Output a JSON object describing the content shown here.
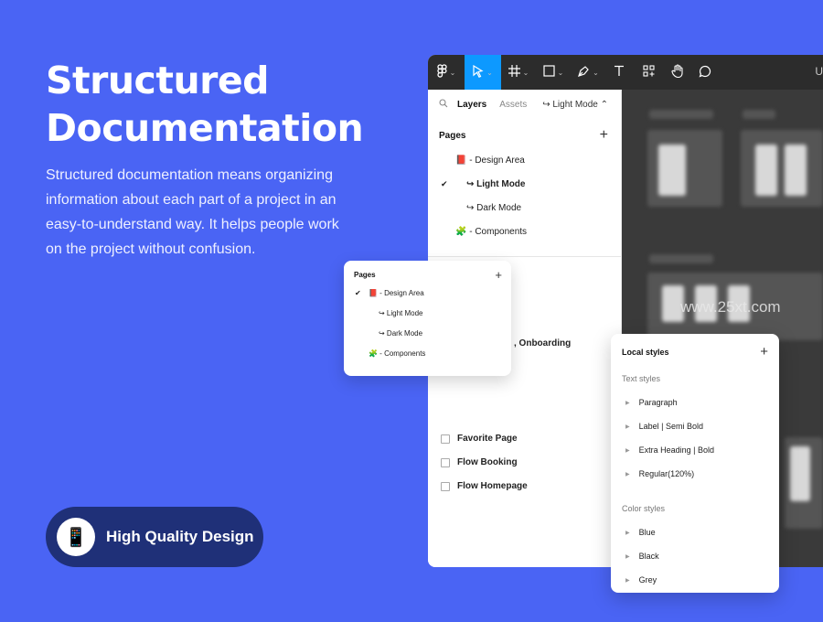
{
  "hero": {
    "title_line1": "Structured",
    "title_line2": "Documentation",
    "desc_lines": [
      "Structured documentation means organizing",
      "information about each part of a project in an",
      "easy-to-understand way. It helps people work",
      "on the project without confusion."
    ]
  },
  "badge": {
    "label": "High Quality Design",
    "icon": "📱"
  },
  "app": {
    "toolbar_user": "U",
    "tabs": {
      "layers": "Layers",
      "assets": "Assets",
      "mode": "↪ Light Mode ⌃"
    },
    "pages_label": "Pages",
    "pages": [
      {
        "label": "📕 - Design Area",
        "selected": false
      },
      {
        "label": "↪ Light Mode",
        "selected": true
      },
      {
        "label": "↪ Dark Mode",
        "selected": false
      },
      {
        "label": "🧩 - Components",
        "selected": false
      }
    ],
    "layer_onboarding": ", Onboarding",
    "layers": [
      "Favorite Page",
      "Flow Booking",
      "Flow Homepage"
    ],
    "watermark": "www.25xt.com"
  },
  "pages_card": {
    "title": "Pages",
    "items": [
      "📕 - Design Area",
      "↪ Light Mode",
      "↪ Dark Mode",
      "🧩 - Components"
    ]
  },
  "styles_card": {
    "title": "Local styles",
    "text_section": "Text styles",
    "text_styles": [
      "Paragraph",
      "Label | Semi Bold",
      "Extra Heading | Bold",
      "Regular(120%)"
    ],
    "color_section": "Color styles",
    "color_styles": [
      "Blue",
      "Black",
      "Grey"
    ]
  }
}
